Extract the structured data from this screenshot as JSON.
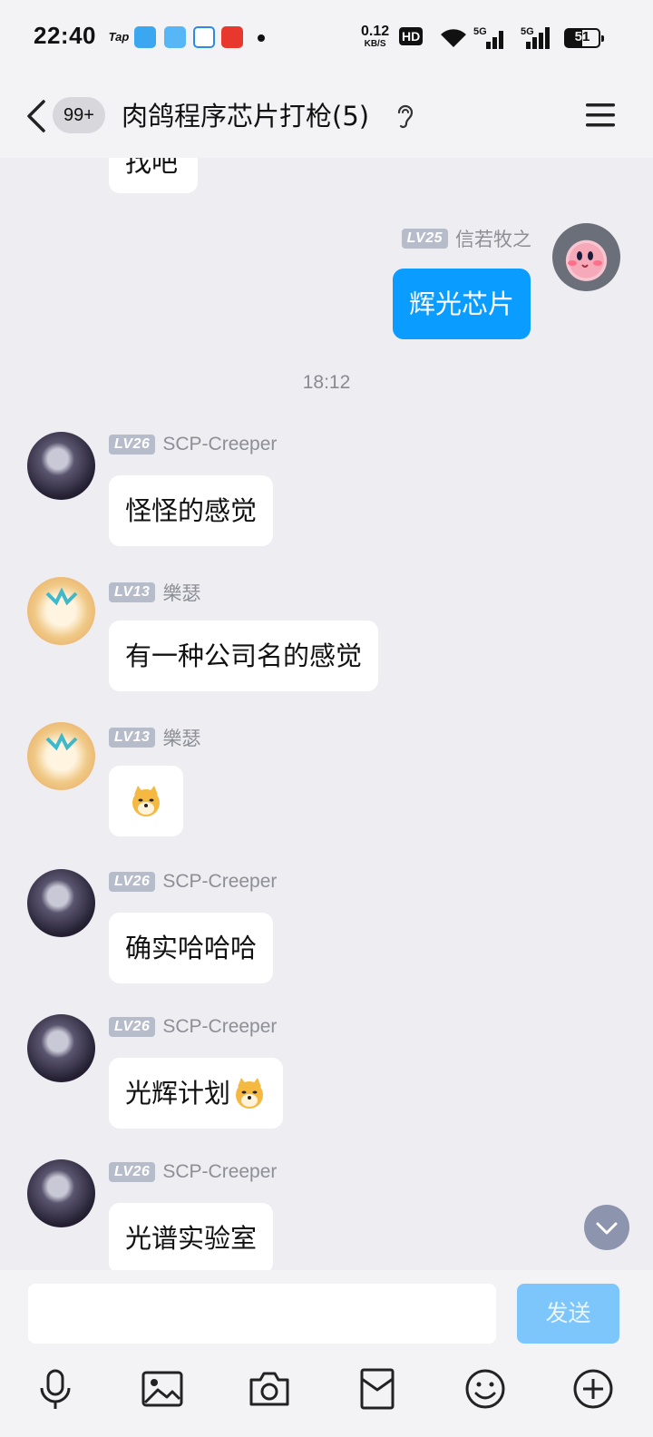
{
  "status_bar": {
    "time": "22:40",
    "app_icons": [
      "Tap",
      "weather",
      "app",
      "chat",
      "music"
    ],
    "net_speed_value": "0.12",
    "net_speed_unit": "KB/S",
    "hd_label": "HD",
    "network_1": "5G",
    "network_2": "5G",
    "battery": "51"
  },
  "header": {
    "unread_badge": "99+",
    "title": "肉鸽程序芯片打枪(5)"
  },
  "messages": {
    "partial_text": "找吧",
    "m0": {
      "level": "LV25",
      "name": "信若牧之",
      "text": "辉光芯片"
    },
    "time_divider": "18:12",
    "m1": {
      "level": "LV26",
      "name": "SCP-Creeper",
      "text": "怪怪的感觉"
    },
    "m2": {
      "level": "LV13",
      "name": "樂瑟",
      "text": "有一种公司名的感觉"
    },
    "m3": {
      "level": "LV13",
      "name": "樂瑟",
      "emoji": "doge-emoji"
    },
    "m4": {
      "level": "LV26",
      "name": "SCP-Creeper",
      "text": "确实哈哈哈"
    },
    "m5": {
      "level": "LV26",
      "name": "SCP-Creeper",
      "text": "光辉计划",
      "emoji": "doge-emoji"
    },
    "m6": {
      "level": "LV26",
      "name": "SCP-Creeper",
      "text": "光谱实验室"
    }
  },
  "composer": {
    "input_value": "",
    "send_label": "发送",
    "tools": [
      "microphone-icon",
      "image-icon",
      "camera-icon",
      "red-packet-icon",
      "emoji-icon",
      "plus-icon"
    ]
  },
  "colors": {
    "own_bubble": "#0a9cff",
    "send_button": "#7dc6fb",
    "background": "#ededf2"
  }
}
